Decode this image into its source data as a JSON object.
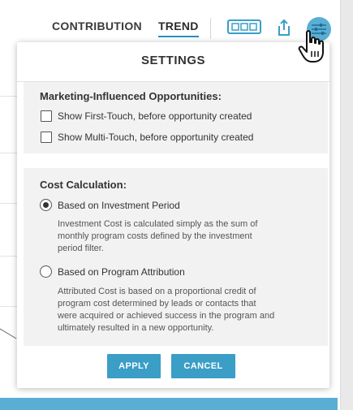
{
  "header": {
    "tabs": [
      {
        "label": "CONTRIBUTION",
        "active": false
      },
      {
        "label": "TREND",
        "active": true
      }
    ],
    "tools": {
      "view_icon": "grid-view-icon",
      "share_icon": "share-icon",
      "settings_icon": "sliders-icon"
    }
  },
  "settings": {
    "title": "SETTINGS",
    "marketing": {
      "heading": "Marketing-Influenced Opportunities:",
      "options": [
        {
          "label": "Show First-Touch, before opportunity created",
          "checked": false
        },
        {
          "label": "Show Multi-Touch, before opportunity created",
          "checked": false
        }
      ]
    },
    "cost": {
      "heading": "Cost Calculation:",
      "options": [
        {
          "label": "Based on Investment Period",
          "selected": true,
          "description_lines": [
            "Investment Cost is calculated simply as the sum of",
            "monthly program costs defined by the investment",
            "period filter."
          ]
        },
        {
          "label": "Based on Program Attribution",
          "selected": false,
          "description_lines": [
            "Attributed Cost is based on a proportional credit of",
            "program cost determined by leads or contacts that",
            "were acquired or achieved success in the program and",
            "ultimately resulted in a new opportunity."
          ]
        }
      ]
    },
    "buttons": {
      "apply": "APPLY",
      "cancel": "CANCEL"
    }
  },
  "colors": {
    "accent": "#3a9ec6",
    "settings_bubble": "#5aaed3",
    "section_bg": "#f2f2f2"
  }
}
